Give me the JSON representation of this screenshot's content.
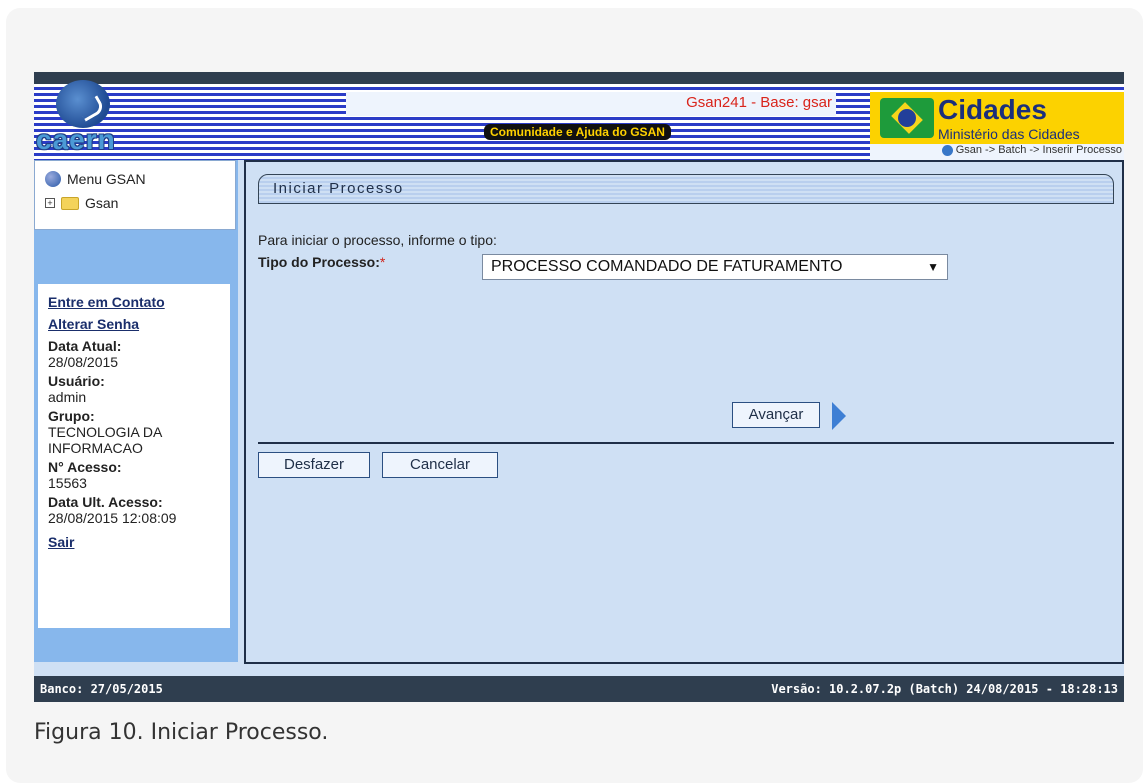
{
  "header": {
    "logo_text": "caern",
    "title": "Gsan241 - Base: gsar",
    "community_link": "Comunidade e Ajuda do GSAN",
    "ministry_title": "Cidades",
    "ministry_subtitle": "Ministério das Cidades",
    "breadcrumb": "Gsan -> Batch -> Inserir Processo"
  },
  "sidebar": {
    "menu_label": "Menu GSAN",
    "tree_root": "Gsan",
    "contact_link": "Entre em Contato",
    "password_link": "Alterar Senha",
    "date_label": "Data Atual:",
    "date_value": "28/08/2015",
    "user_label": "Usuário:",
    "user_value": "admin",
    "group_label": "Grupo:",
    "group_value_1": "TECNOLOGIA DA",
    "group_value_2": "INFORMACAO",
    "access_label": "N° Acesso:",
    "access_value": "15563",
    "last_access_label": "Data Ult. Acesso:",
    "last_access_value": "28/08/2015 12:08:09",
    "logout_link": "Sair"
  },
  "main": {
    "panel_title": "Iniciar Processo",
    "instruction": "Para iniciar o processo, informe o tipo:",
    "field_label": "Tipo do Processo:",
    "required_mark": "*",
    "selected_option": "PROCESSO COMANDADO DE FATURAMENTO",
    "next_button": "Avançar",
    "undo_button": "Desfazer",
    "cancel_button": "Cancelar"
  },
  "footer": {
    "left": "Banco: 27/05/2015",
    "right": "Versão: 10.2.07.2p (Batch) 24/08/2015 - 18:28:13"
  },
  "caption": "Figura 10. Iniciar Processo."
}
